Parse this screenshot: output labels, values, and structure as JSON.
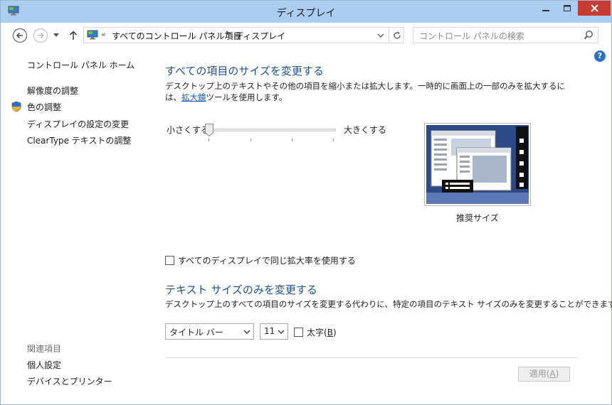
{
  "window": {
    "title": "ディスプレイ"
  },
  "address": {
    "crumb_prefix": "«",
    "crumb_1": "すべてのコントロール パネル項目",
    "crumb_sep": "▶",
    "crumb_2": "ディスプレイ"
  },
  "search": {
    "placeholder": "コントロール パネルの検索"
  },
  "sidebar": {
    "home": "コントロール パネル ホーム",
    "items": [
      "解像度の調整",
      "色の調整",
      "ディスプレイの設定の変更",
      "ClearType テキストの調整"
    ],
    "related_header": "関連項目",
    "related": [
      "個人設定",
      "デバイスとプリンター"
    ]
  },
  "help": {
    "glyph": "?"
  },
  "section1": {
    "title": "すべての項目のサイズを変更する",
    "desc_before": "デスクトップ上のテキストやその他の項目を縮小または拡大します。一時的に画面上の一部のみを拡大するには、",
    "desc_link": "拡大鏡",
    "desc_after": "ツールを使用します。",
    "slider_small": "小さくする",
    "slider_large": "大きくする",
    "slider_value": 0,
    "preview_caption": "推奨サイズ",
    "same_scale_checkbox": "すべてのディスプレイで同じ拡大率を使用する",
    "same_scale_checked": false
  },
  "section2": {
    "title": "テキスト サイズのみを変更する",
    "desc": "デスクトップ上のすべての項目のサイズを変更する代わりに、特定の項目のテキスト サイズのみを変更することができます。",
    "item_select": "タイトル バー",
    "size_select": "11",
    "bold_label": "太字",
    "bold_hotkey": "B",
    "bold_checked": false
  },
  "footer": {
    "apply_label": "適用",
    "apply_hotkey": "A"
  },
  "colors": {
    "titlebar": "#abcdf0",
    "close_button": "#c73b32",
    "heading": "#1e4f9e",
    "link": "#1a57b8"
  }
}
